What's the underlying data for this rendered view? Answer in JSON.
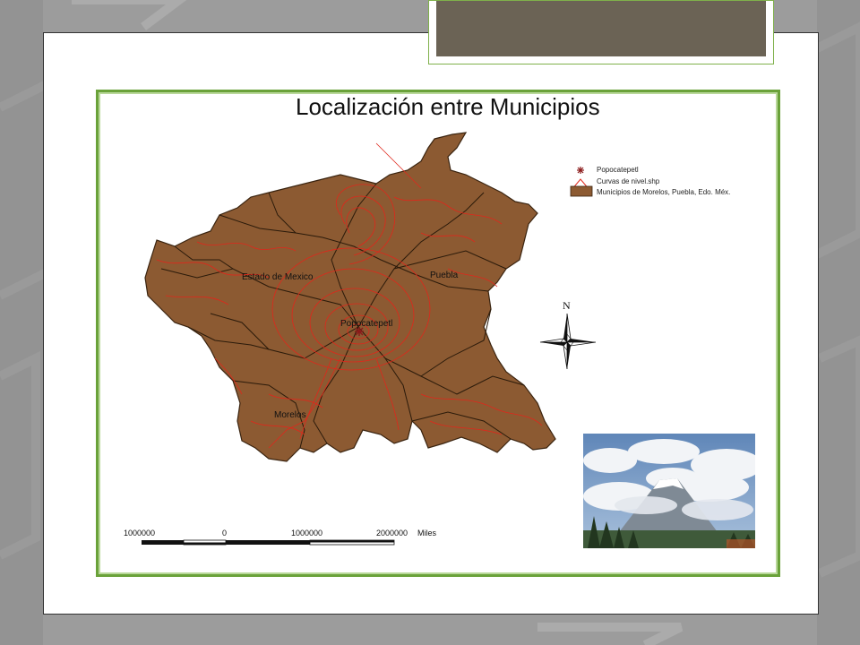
{
  "map": {
    "title": "Localización entre Municipios",
    "legend": [
      {
        "label": "Popocatepetl",
        "icon": "asterisk-icon",
        "color": "#8b1a1a"
      },
      {
        "label": "Curvas de nivel.shp",
        "icon": "line-icon",
        "color": "#e0271b"
      },
      {
        "label": "Municipios de Morelos, Puebla, Edo. Méx.",
        "icon": "polygon-icon",
        "color": "#8c5a32"
      }
    ],
    "regions": {
      "edomex": "Estado de Mexico",
      "puebla": "Puebla",
      "morelos": "Morelos",
      "volcano": "Popocatepetl"
    },
    "north_label": "N",
    "scale": {
      "ticks": [
        "1000000",
        "0",
        "1000000",
        "2000000"
      ],
      "unit": "Miles"
    }
  },
  "colors": {
    "municipality_fill": "#8c5a32",
    "contour": "#e0271b",
    "frame": "#6aa23a",
    "title_box": "#6b6355"
  }
}
